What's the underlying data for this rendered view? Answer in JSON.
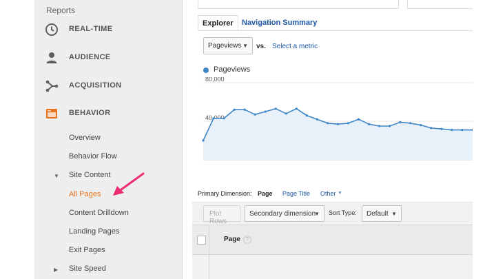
{
  "sidebar": {
    "section_title": "Reports",
    "main_items": [
      {
        "label": "REAL-TIME",
        "icon": "clock-icon"
      },
      {
        "label": "AUDIENCE",
        "icon": "person-icon"
      },
      {
        "label": "ACQUISITION",
        "icon": "acquisition-icon"
      },
      {
        "label": "BEHAVIOR",
        "icon": "behavior-icon"
      }
    ],
    "sub_items": [
      {
        "label": "Overview"
      },
      {
        "label": "Behavior Flow"
      },
      {
        "label": "Site Content",
        "expanded": true
      },
      {
        "label": "All Pages",
        "active": true
      },
      {
        "label": "Content Drilldown"
      },
      {
        "label": "Landing Pages"
      },
      {
        "label": "Exit Pages"
      },
      {
        "label": "Site Speed",
        "expanded": false
      }
    ]
  },
  "tabs": {
    "explorer": "Explorer",
    "navigation_summary": "Navigation Summary"
  },
  "metric": {
    "selected": "Pageviews",
    "vs": "vs.",
    "select_link": "Select a metric"
  },
  "chart_data": {
    "type": "area",
    "series": [
      {
        "name": "Pageviews",
        "values": [
          20000,
          43000,
          43000,
          52000,
          52000,
          47000,
          50000,
          53000,
          48000,
          53000,
          46000,
          42000,
          38000,
          37000,
          38000,
          42000,
          37000,
          35000,
          35000,
          39000,
          38000,
          36000,
          33000,
          32000,
          31000,
          31000,
          31000
        ]
      }
    ],
    "y_ticks": [
      "80,000",
      "40,000"
    ],
    "ylim": [
      0,
      80000
    ],
    "grid": true,
    "color": "#3e86c6"
  },
  "primary_dimension": {
    "label": "Primary Dimension:",
    "current": "Page",
    "options": [
      "Page Title",
      "Other"
    ]
  },
  "controls": {
    "plot_rows": "Plot Rows",
    "secondary_dimension": "Secondary dimension",
    "sort_type_label": "Sort Type:",
    "sort_type_value": "Default"
  },
  "table": {
    "header_page": "Page",
    "help": "?"
  },
  "colors": {
    "accent_orange": "#e8711c",
    "link_blue": "#1a56a4",
    "annotation_arrow": "#ec2d74"
  }
}
